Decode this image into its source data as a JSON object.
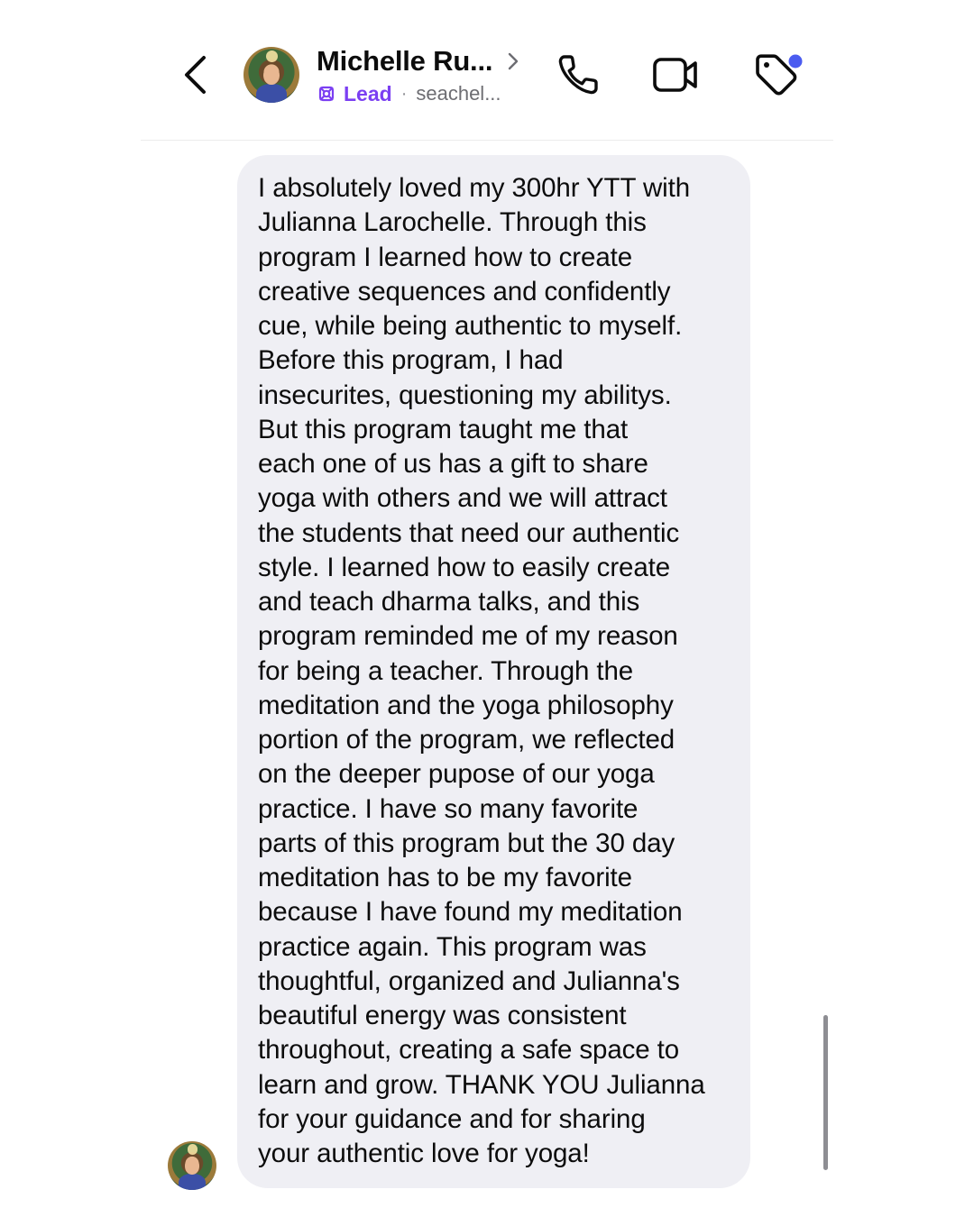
{
  "header": {
    "back_icon": "chevron-left-icon",
    "contact_name": "Michelle Ru...",
    "name_chevron_icon": "chevron-right-icon",
    "lead_icon": "lead-badge-icon",
    "lead_label": "Lead",
    "separator": "·",
    "handle": "seachel...",
    "call_icon": "phone-icon",
    "video_icon": "video-camera-icon",
    "tag_icon": "tag-icon",
    "tag_badge_color": "#4b5cf0",
    "lead_color": "#7b3ff2"
  },
  "message": {
    "bubble_color": "#efeff4",
    "lines": [
      "I absolutely loved my 300hr YTT with",
      "Julianna Larochelle. Through this",
      "program I learned how to create",
      "creative sequences and confidently",
      "cue, while being authentic to myself.",
      "Before this program, I had",
      "insecurites, questioning my abilitys.",
      "But this program taught me that",
      "each one of us has a gift to share",
      "yoga with others and we will attract",
      "the students that need our authentic",
      "style. I learned how to easily create",
      "and teach dharma talks, and this",
      "program reminded me of my reason",
      "for being a teacher. Through the",
      "meditation and the yoga philosophy",
      "portion of the program, we reflected",
      "on the deeper pupose of our yoga",
      "practice. I have so many favorite",
      "parts of this program but the 30 day",
      "meditation has to be my favorite",
      "because I have found my meditation",
      "practice again. This program was",
      "thoughtful, organized and Julianna's",
      "beautiful energy was consistent",
      "throughout, creating a safe space to",
      "learn and grow. THANK YOU Julianna",
      "for your guidance and for sharing",
      "your authentic love for yoga!"
    ]
  }
}
